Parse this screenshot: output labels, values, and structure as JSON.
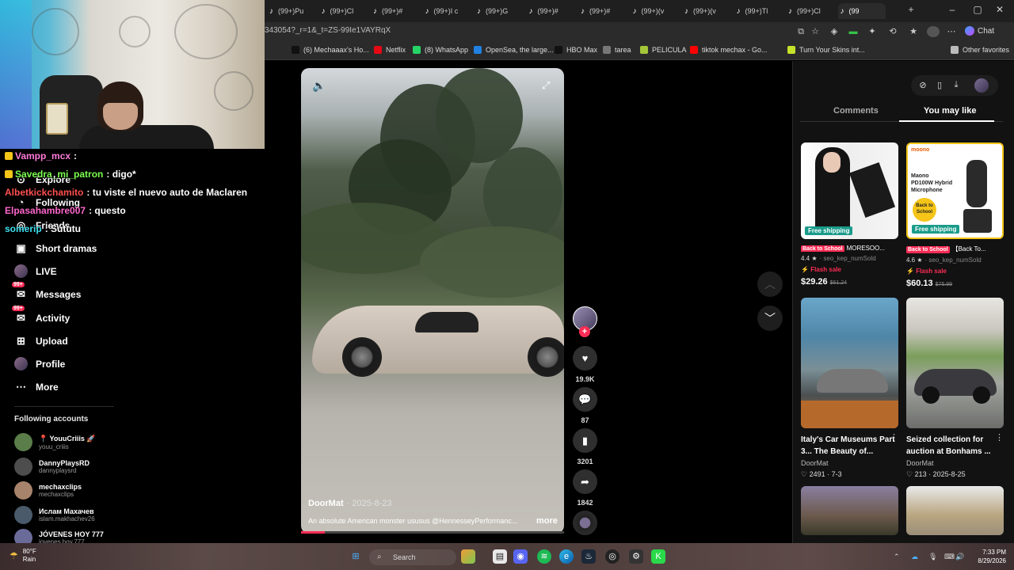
{
  "browser": {
    "tabs": [
      {
        "label": "(99+)Pu",
        "left": 0
      },
      {
        "label": "(99+)Cl",
        "left": 0
      },
      {
        "label": "(99+)#",
        "left": 0
      },
      {
        "label": "(99+)I c",
        "left": 0
      },
      {
        "label": "(99+)G",
        "left": 0
      },
      {
        "label": "(99+)#",
        "left": 0
      },
      {
        "label": "(99+)#",
        "left": 0
      },
      {
        "label": "(99+)(v",
        "left": 0
      },
      {
        "label": "(99+)(v",
        "left": 0
      },
      {
        "label": "(99+)Tl",
        "left": 0
      },
      {
        "label": "(99+)Cl",
        "left": 0
      },
      {
        "label": "(99",
        "left": 0
      }
    ],
    "url": "343054?_r=1&_t=ZS-99Ie1VAYRqX",
    "chat_label": "Chat",
    "bookmarks": [
      {
        "label": "(6) Mechaaax's Ho...",
        "color": "#111111"
      },
      {
        "label": "Netflix",
        "color": "#e50914"
      },
      {
        "label": "(8) WhatsApp",
        "color": "#25d366"
      },
      {
        "label": "OpenSea, the large...",
        "color": "#2081e2"
      },
      {
        "label": "HBO Max",
        "color": "#111111"
      },
      {
        "label": "tarea",
        "color": "#777777"
      },
      {
        "label": "PELICULA",
        "color": "#a4c639"
      },
      {
        "label": "tiktok mechax - Go...",
        "color": "#ff0000"
      },
      {
        "label": "Turn Your Skins int...",
        "color": "#c6e22a"
      }
    ],
    "other_favorites": "Other favorites"
  },
  "chat": [
    {
      "user": "Vampp_mcx",
      "msg": ":",
      "color": "#ff7ad9"
    },
    {
      "user": "Savedra_mi_patron",
      "msg": ": digo*",
      "color": "#7cff4f"
    },
    {
      "user": "Albetkickchamito",
      "msg": ": tu viste el nuevo auto de Maclaren",
      "color": "#ff4f4f"
    },
    {
      "user": "Elpasahambre007",
      "msg": ": questo",
      "color": "#ff66cc"
    },
    {
      "user": "somerip",
      "msg": ": Sututu",
      "color": "#3fe0f0"
    }
  ],
  "sidebar": {
    "nav": [
      {
        "label": "Explore",
        "icon": "compass-icon"
      },
      {
        "label": "Following",
        "icon": "following-icon"
      },
      {
        "label": "Friends",
        "icon": "friends-icon"
      },
      {
        "label": "Short dramas",
        "icon": "short-dramas-icon"
      },
      {
        "label": "LIVE",
        "icon": "live-icon"
      },
      {
        "label": "Messages",
        "icon": "messages-icon",
        "badge": "99+"
      },
      {
        "label": "Activity",
        "icon": "activity-icon",
        "badge": "99+"
      },
      {
        "label": "Upload",
        "icon": "upload-icon"
      },
      {
        "label": "Profile",
        "icon": "profile-avatar"
      },
      {
        "label": "More",
        "icon": "more-icon"
      }
    ],
    "following_title": "Following accounts",
    "accounts": [
      {
        "name": "📍 YouuCriiis 🚀",
        "handle": "youu_criiis",
        "color": "#5a7d4a"
      },
      {
        "name": "DannyPlaysRD",
        "handle": "dannyplaysrd",
        "color": "#4d4d4d"
      },
      {
        "name": "mechaxclips",
        "handle": "mechaxclips",
        "color": "#a8836b"
      },
      {
        "name": "Ислам Махачев",
        "handle": "islam.makhachev26",
        "color": "#4a5a6b"
      },
      {
        "name": "JÓVENES HOY 777",
        "handle": "jovenes.hoy.777",
        "color": "#6b6b9a"
      }
    ]
  },
  "video": {
    "author": "DoorMat",
    "date": "· 2025-8-23",
    "description": "An absolute American monster ususus @HennesseyPerformanc...",
    "more": "more",
    "progress": 0.09
  },
  "actions": {
    "likes": "19.9K",
    "comments": "87",
    "saves": "3201",
    "shares": "1842"
  },
  "right_panel": {
    "tab_comments": "Comments",
    "tab_you_may_like": "You may like",
    "products": [
      {
        "tag": "Back to School",
        "title": "MORESOO...",
        "rating": "4.4 ★",
        "sold": "· seo_kep_numSold",
        "flash": "Flash sale",
        "price": "$29.26",
        "old_price": "$61.24",
        "free": "Free shipping"
      },
      {
        "tag": "Back to School",
        "title": "【Back To...",
        "rating": "4.6 ★",
        "sold": "· seo_kep_numSold",
        "flash": "Flash sale",
        "price": "$60.13",
        "old_price": "$75.99",
        "free": "Free shipping"
      }
    ],
    "videos": [
      {
        "title": "Italy's Car Museums Part 3... The Beauty of...",
        "author": "DoorMat",
        "likes": "♡ 2491",
        "date": "· 7-3"
      },
      {
        "title": "Seized collection for auction at Bonhams ...",
        "author": "DoorMat",
        "likes": "♡ 213",
        "date": "· 2025-8-25"
      }
    ]
  },
  "taskbar": {
    "temp": "80°F",
    "weather": "Rain",
    "search": "Search",
    "time": "7:33 PM",
    "date": "8/29/2026"
  }
}
